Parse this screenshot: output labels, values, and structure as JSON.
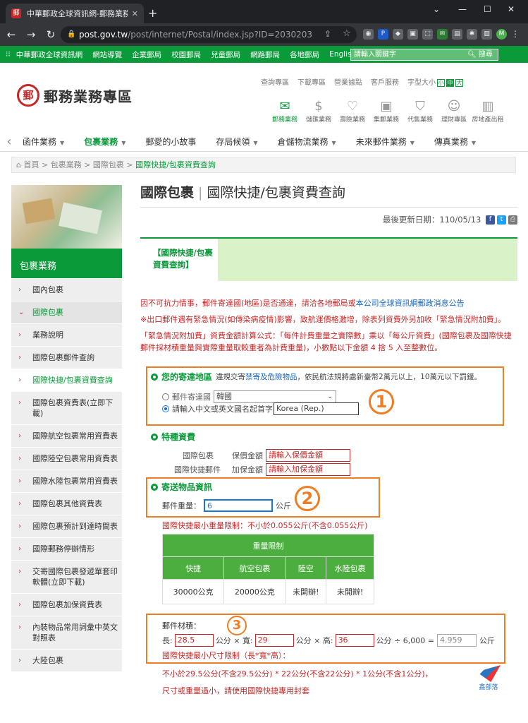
{
  "browser": {
    "tab_title": "中華郵政全球資訊網-郵務業務 - 包",
    "url_domain": "post.gov.tw",
    "url_path": "/post/internet/Postal/index.jsp?ID=2030203",
    "profile_initial": "M"
  },
  "topbar": {
    "links": [
      "中華郵政全球資訊網",
      "網站導覽",
      "企業郵局",
      "校園郵局",
      "兒童郵局",
      "網路郵局",
      "各地郵局",
      "English"
    ],
    "search_placeholder": "請輸入關鍵字",
    "search_button": "搜尋"
  },
  "header": {
    "logo_mark": "郵",
    "logo_text": "郵務業務專區",
    "utility": [
      "查詢專區",
      "下載專區",
      "營業據點",
      "客戶服務",
      "字型大小"
    ],
    "font_sizes": [
      "小",
      "中",
      "大"
    ],
    "quick": [
      {
        "label": "郵務業務",
        "icon": "envelope-icon"
      },
      {
        "label": "儲匯業務",
        "icon": "dollar-icon"
      },
      {
        "label": "壽險業務",
        "icon": "hands-heart-icon"
      },
      {
        "label": "集郵業務",
        "icon": "stamp-icon"
      },
      {
        "label": "代售業務",
        "icon": "bag-icon"
      },
      {
        "label": "理財專區",
        "icon": "advisor-icon"
      },
      {
        "label": "房地產出租",
        "icon": "building-icon"
      }
    ]
  },
  "nav": {
    "items": [
      "函件業務",
      "包裹業務",
      "郵愛的小故事",
      "存局候領",
      "倉儲物流業務",
      "未來郵件業務",
      "傳真業務"
    ]
  },
  "breadcrumb": [
    "首頁",
    "包裹業務",
    "國際包裹",
    "國際快捷/包裹資費查詢"
  ],
  "sidebar": {
    "heading": "包裹業務",
    "items": [
      {
        "label": "國內包裹",
        "type": "top"
      },
      {
        "label": "國際包裹",
        "type": "open"
      },
      {
        "label": "業務說明",
        "type": "sub"
      },
      {
        "label": "國際包裹郵件查詢",
        "type": "sub"
      },
      {
        "label": "國際快捷/包裹資費查詢",
        "type": "sub-sel"
      },
      {
        "label": "國際包裹資費表(立即下載)",
        "type": "sub"
      },
      {
        "label": "國際航空包裹常用資費表",
        "type": "sub"
      },
      {
        "label": "國際陸空包裹常用資費表",
        "type": "sub"
      },
      {
        "label": "國際水陸包裹常用資費表",
        "type": "sub"
      },
      {
        "label": "國際包裹其他資費表",
        "type": "sub"
      },
      {
        "label": "國際包裹預計到達時間表",
        "type": "sub"
      },
      {
        "label": "國際郵務停辦情形",
        "type": "sub"
      },
      {
        "label": "交寄國際包裹發遞單套印軟體(立即下載)",
        "type": "sub"
      },
      {
        "label": "國際包裹加保資費表",
        "type": "sub"
      },
      {
        "label": "內裝物品常用詞彙中英文對照表",
        "type": "sub"
      },
      {
        "label": "大陸包裹",
        "type": "top"
      }
    ]
  },
  "main": {
    "title_bold": "國際包裹",
    "title_rest": "國際快捷/包裹資費查詢",
    "updated": "最後更新日期：110/05/13",
    "tab_label": "【國際快捷/包裹資費查詢】",
    "notice1_a": "因不可抗力情事，郵件寄達國(地區)是否通達，請洽各地郵局或",
    "notice1_link": "本公司全球資訊網郵政消息公告",
    "notice2": "※出口郵件遇有緊急情況(如傳染病疫情)影響，致航運價格激增，除表列資費外另加收「緊急情況附加費」。",
    "notice3": "「緊急情況附加費」資費金額計算公式：「每件計費重量之實際數」乘以「每公斤資費」(國際包裹及國際快捷郵件採材積重量與實際重量取較重者為計費重量)，小數點以下金額 4 捨 5 入至整數位。",
    "dest": {
      "heading": "您的寄達地區",
      "note_a": "違規交寄",
      "note_link": "禁寄及危險物品",
      "note_b": "，依民航法規將處新臺幣2萬元以上，10萬元以下罰鍰。",
      "opt1": "郵件寄達國",
      "opt1_value": "韓國",
      "opt2": "請輸入中文或英文國名起首字",
      "opt2_value": "Korea (Rep.)"
    },
    "special": {
      "heading": "特種資費",
      "row1_label": "國際包裹",
      "row1_field": "保價金額",
      "row1_ph": "請輸入保價金額",
      "row2_label": "國際快捷郵件",
      "row2_field": "加保金額",
      "row2_ph": "請輸入加保金額"
    },
    "item": {
      "heading": "寄送物品資訊",
      "weight_label": "郵件重量：",
      "weight_value": "6",
      "weight_unit": "公斤",
      "limit_note": "國際快捷最小重量限制：不小於0.055公斤(不含0.055公斤)"
    },
    "table": {
      "title": "重量限制",
      "headers": [
        "快捷",
        "航空包裹",
        "陸空",
        "水陸包裹"
      ],
      "values": [
        "30000公克",
        "20000公克",
        "未開辦!",
        "未開辦!"
      ]
    },
    "volume": {
      "label": "郵件材積：",
      "l_label": "長:",
      "l_value": "28.5",
      "w_label": "公分 × 寬:",
      "w_value": "29",
      "h_label": "公分 × 高:",
      "h_value": "36",
      "div_label": "公分 ÷ 6,000 =",
      "result": "4.959",
      "unit": "公斤",
      "min_note": "國際快捷最小尺寸限制（長*寬*高）：",
      "min_detail": "不小於29.5公分(不含29.5公分) * 22公分(不含22公分) * 1公分(不含1公分)，",
      "small_note": "尺寸或重量過小，請使用國際快捷專用封套"
    },
    "markers": [
      "1",
      "2",
      "3"
    ]
  },
  "watermark": "鑫部落"
}
